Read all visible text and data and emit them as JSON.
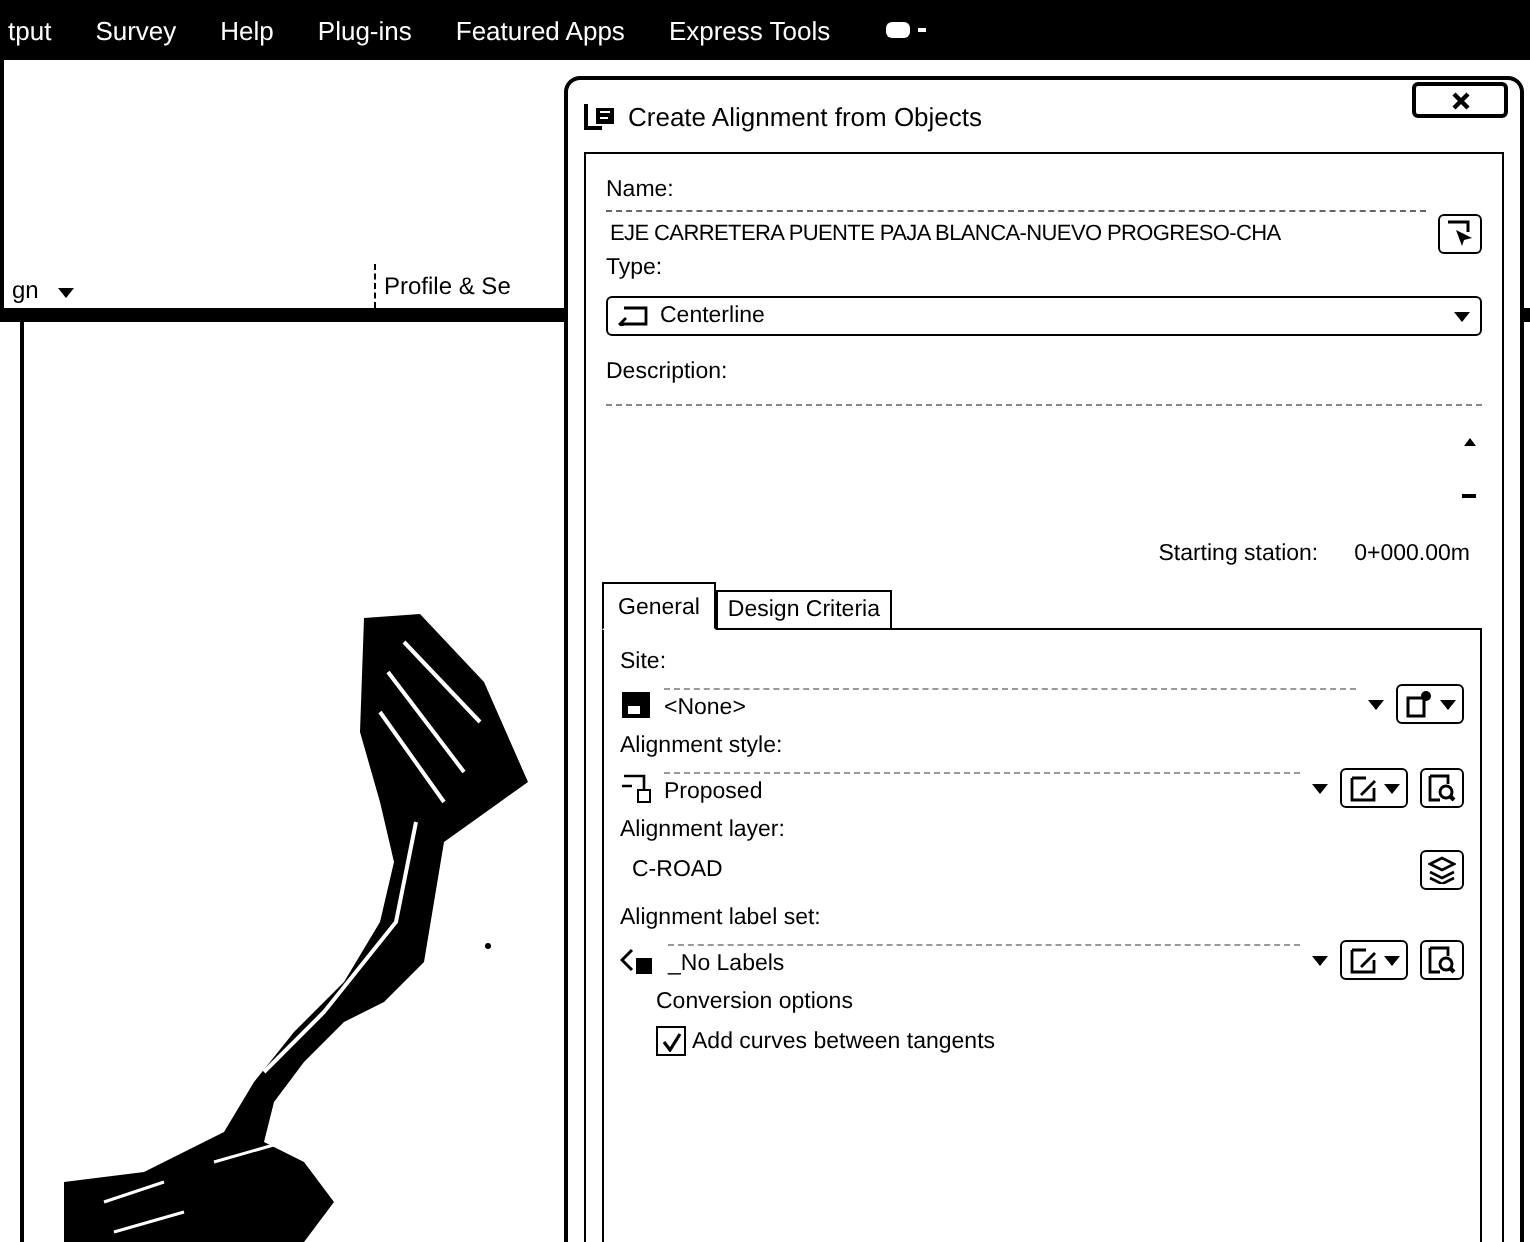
{
  "menu_bar": {
    "items": [
      "tput",
      "Survey",
      "Help",
      "Plug-ins",
      "Featured Apps",
      "Express Tools"
    ]
  },
  "ribbon": {
    "panels": [
      {
        "label": "gn",
        "dropdown": true
      },
      {
        "label": "Profile & Se",
        "dropdown": false
      }
    ]
  },
  "dialog": {
    "title": "Create Alignment from Objects",
    "name": {
      "label": "Name:",
      "value": "EJE CARRETERA PUENTE PAJA BLANCA-NUEVO PROGRESO-CHA"
    },
    "type": {
      "label": "Type:",
      "value": "Centerline"
    },
    "description": {
      "label": "Description:"
    },
    "starting_station": {
      "label": "Starting station:",
      "value": "0+000.00m"
    },
    "tabs": [
      {
        "label": "General",
        "selected": true
      },
      {
        "label": "Design Criteria",
        "selected": false
      }
    ],
    "general": {
      "site": {
        "label": "Site:",
        "value": "<None>"
      },
      "alignment_style": {
        "label": "Alignment style:",
        "value": "Proposed"
      },
      "alignment_layer": {
        "label": "Alignment layer:",
        "value": "C-ROAD"
      },
      "alignment_label_set": {
        "label": "Alignment label set:",
        "value": "_No Labels"
      },
      "conversion_options": {
        "label": "Conversion options",
        "add_curves": {
          "label": "Add curves between tangents",
          "checked": true
        }
      }
    }
  }
}
